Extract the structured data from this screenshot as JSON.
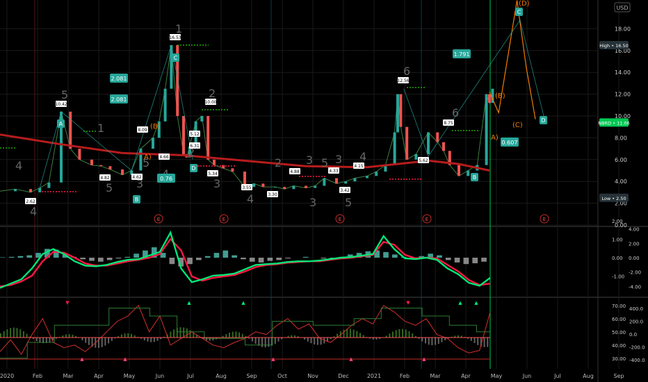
{
  "chart_data": {
    "type": "line",
    "symbol": "NBRD",
    "currency": "USD",
    "x_ticks": [
      "2020",
      "Feb",
      "Mar",
      "Apr",
      "May",
      "Jun",
      "Jul",
      "Aug",
      "Sep",
      "Oct",
      "Nov",
      "Dec",
      "2021",
      "Feb",
      "Mar",
      "Apr",
      "May",
      "Jun",
      "Jul",
      "Aug",
      "Sep"
    ],
    "y_ticks_main": [
      0.0,
      2.0,
      4.0,
      6.0,
      8.0,
      10.0,
      12.0,
      14.0,
      16.0,
      18.0
    ],
    "y_ticks_osc": [
      4.0,
      2.0,
      0.0,
      -2.0,
      -4.0
    ],
    "y_ticks_osc_left": [
      2.0,
      1.0,
      0.0,
      -1.0
    ],
    "y_ticks_ind_left": [
      70.0,
      60.0,
      50.0,
      40.0,
      30.0
    ],
    "y_ticks_ind_right": [
      400.0,
      200.0,
      0.0,
      -200.0,
      -400.0
    ],
    "ylim": [
      0,
      20.6
    ],
    "price_labels": {
      "high": "High • 16.50",
      "current": "NBRD • 11.06",
      "low": "Low • 2.50"
    },
    "colors": {
      "up": "#26a69a",
      "down": "#ef5350",
      "ma": "#b71c1c",
      "wave": "#26a69a",
      "projection": "#f57c00",
      "signal_green": "#00e676",
      "signal_red": "#ff1744"
    },
    "price": {
      "t": [
        0.0,
        0.5,
        1.0,
        1.3,
        1.6,
        2.0,
        2.3,
        2.6,
        3.0,
        3.3,
        3.6,
        4.0,
        4.3,
        4.6,
        5.0,
        5.2,
        5.4,
        5.6,
        5.8,
        6.0,
        6.1,
        6.2,
        6.4,
        6.6,
        6.8,
        7.0,
        7.3,
        7.6,
        8.0,
        8.3,
        8.6,
        9.0,
        9.3,
        9.6,
        10.0,
        10.3,
        10.6,
        11.0,
        11.3,
        11.6,
        12.0,
        12.3,
        12.6,
        12.9,
        13.0,
        13.1,
        13.3,
        13.6,
        14.0,
        14.3,
        14.5,
        14.7,
        15.0,
        15.3,
        15.6,
        15.9,
        16.0,
        16.1
      ],
      "v": [
        3.1,
        3.3,
        3.0,
        3.4,
        3.9,
        10.4,
        7.0,
        6.0,
        5.5,
        5.4,
        5.1,
        4.6,
        5.0,
        7.0,
        8.0,
        9.5,
        12.5,
        16.5,
        10.0,
        6.5,
        6.2,
        7.2,
        9.5,
        10.0,
        6.0,
        5.5,
        5.2,
        4.9,
        3.5,
        3.8,
        3.5,
        3.5,
        3.3,
        3.6,
        3.4,
        3.6,
        4.3,
        3.8,
        4.0,
        4.3,
        4.5,
        4.9,
        5.5,
        8.5,
        12.0,
        9.0,
        6.0,
        6.5,
        8.5,
        7.6,
        6.8,
        5.5,
        4.5,
        5.0,
        5.5,
        12.0,
        11.2,
        12.5
      ]
    },
    "ma_line": {
      "t": [
        0.0,
        2.0,
        4.0,
        6.0,
        8.0,
        10.0,
        12.0,
        13.0,
        14.0,
        15.0,
        16.0
      ],
      "v": [
        8.3,
        7.4,
        6.6,
        6.4,
        5.9,
        5.4,
        5.3,
        5.6,
        5.9,
        5.6,
        5.0
      ]
    },
    "projection_wave": {
      "t": [
        16.0,
        16.3,
        16.9,
        17.2,
        17.5
      ],
      "v": [
        12.2,
        10.3,
        20.6,
        14.5,
        9.7
      ]
    },
    "projection_labels": [
      "(B)",
      "(C)",
      "(D)",
      "C",
      "D",
      "A)"
    ],
    "fib_ratios": [
      "2.081",
      "2.081",
      "0.76",
      "1.791",
      "0.607"
    ],
    "wave_counts": [
      "4",
      "5",
      "4",
      "5",
      "1",
      "2",
      "3",
      "4",
      "5",
      "2",
      "3",
      "3",
      "4",
      "5",
      "3",
      "6",
      "6",
      "3",
      "5",
      "4",
      "2",
      "1"
    ],
    "wave_letters": [
      "A",
      "B",
      "C",
      "D",
      "(B)",
      "A)",
      "C",
      "B"
    ],
    "price_flags": [
      "2.62",
      "10.42",
      "4.82",
      "4.62",
      "8.09",
      "4.66",
      "16.53",
      "6.31",
      "10.00",
      "5.34",
      "3.55",
      "5.12",
      "4.88",
      "3.30",
      "4.33",
      "3.42",
      "4.15",
      "12.56",
      "5.62",
      "8.75"
    ],
    "earnings_markers": [
      "E",
      "E",
      "E",
      "E",
      "E"
    ],
    "macd_hist": [
      0.05,
      0.1,
      0.2,
      0.3,
      0.6,
      1.1,
      1.0,
      0.4,
      0.1,
      -0.2,
      -0.4,
      -0.5,
      -0.3,
      -0.1,
      0.1,
      0.5,
      0.9,
      1.3,
      0.6,
      -0.8,
      -1.1,
      -0.8,
      -0.3,
      0.2,
      0.6,
      0.9,
      0.3,
      -0.2,
      -0.5,
      -0.6,
      -0.4,
      -0.3,
      -0.1,
      0.0,
      0.1,
      0.0,
      -0.1,
      -0.2,
      0.1,
      0.4,
      0.6,
      0.8,
      0.9,
      0.7,
      0.4,
      0.1,
      -0.1,
      0.2,
      0.5,
      0.3,
      -0.3,
      -0.6,
      -0.8,
      -0.7,
      -0.5
    ],
    "osc_fast": [
      -4.2,
      -3.6,
      -3.0,
      -1.5,
      0.5,
      1.2,
      0.5,
      -0.5,
      -1.1,
      -1.2,
      -1.0,
      -0.6,
      -0.3,
      -0.2,
      0.3,
      0.8,
      3.5,
      -1.5,
      -3.4,
      -3.0,
      -2.5,
      -2.4,
      -2.2,
      -1.6,
      -1.0,
      -0.9,
      -0.8,
      -0.6,
      -0.5,
      -0.5,
      -0.4,
      -0.2,
      0.0,
      0.1,
      0.3,
      0.5,
      3.0,
      1.2,
      -0.1,
      -0.2,
      0.0,
      -0.3,
      -1.5,
      -2.3,
      -3.5,
      -3.9,
      -2.8
    ],
    "osc_slow": [
      -4.0,
      -3.8,
      -3.3,
      -2.5,
      -0.5,
      0.8,
      0.7,
      0.0,
      -0.8,
      -1.1,
      -1.1,
      -0.8,
      -0.5,
      -0.3,
      0.0,
      0.5,
      2.6,
      1.0,
      -2.6,
      -3.2,
      -2.8,
      -2.6,
      -2.4,
      -1.9,
      -1.3,
      -1.0,
      -0.9,
      -0.7,
      -0.6,
      -0.5,
      -0.5,
      -0.3,
      -0.1,
      0.0,
      0.2,
      0.4,
      2.2,
      1.8,
      0.4,
      -0.1,
      0.0,
      -0.1,
      -1.0,
      -1.9,
      -3.1,
      -3.8,
      -3.6
    ],
    "ind_red_line": [
      35,
      44,
      33,
      48,
      60,
      42,
      38,
      40,
      35,
      42,
      50,
      58,
      62,
      70,
      50,
      62,
      40,
      45,
      50,
      45,
      40,
      38,
      42,
      45,
      50,
      48,
      55,
      60,
      52,
      56,
      45,
      42,
      48,
      55,
      60,
      56,
      70,
      65,
      58,
      55,
      60,
      48,
      45,
      38,
      34,
      36,
      65
    ],
    "ind_step_line": [
      30,
      30,
      42,
      42,
      55,
      55,
      55,
      55,
      68,
      68,
      68,
      62,
      62,
      50,
      50,
      45,
      45,
      45,
      40,
      40,
      58,
      58,
      58,
      55,
      55,
      55,
      60,
      60,
      68,
      68,
      68,
      62,
      62,
      55,
      55,
      50
    ]
  }
}
